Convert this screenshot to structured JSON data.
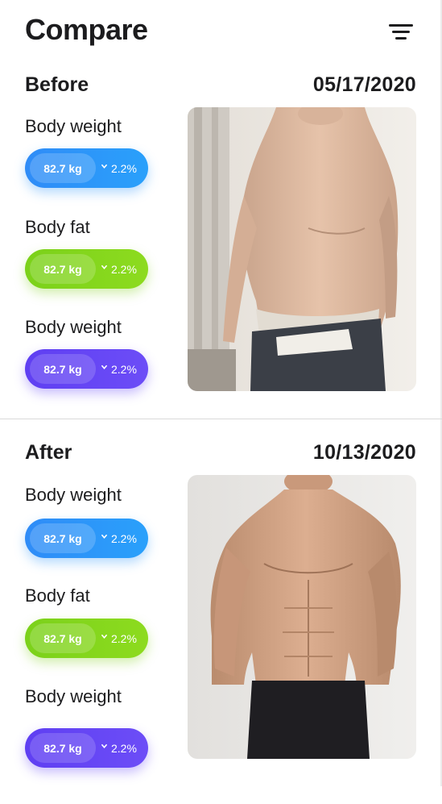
{
  "header": {
    "title": "Compare",
    "filter_icon": "filter-icon"
  },
  "before": {
    "title": "Before",
    "date": "05/17/2020",
    "photo": "body-photo-before",
    "metrics": [
      {
        "label": "Body weight",
        "value": "82.7 kg",
        "delta": "2.2%",
        "color": "#2f8cf7",
        "trend": "down"
      },
      {
        "label": "Body fat",
        "value": "82.7 kg",
        "delta": "2.2%",
        "color": "#7bd11a",
        "trend": "down"
      },
      {
        "label": "Body weight",
        "value": "82.7 kg",
        "delta": "2.2%",
        "color": "#5f3ff2",
        "trend": "down"
      }
    ]
  },
  "after": {
    "title": "After",
    "date": "10/13/2020",
    "photo": "body-photo-after",
    "metrics": [
      {
        "label": "Body weight",
        "value": "82.7 kg",
        "delta": "2.2%",
        "color": "#2f8cf7",
        "trend": "down"
      },
      {
        "label": "Body fat",
        "value": "82.7 kg",
        "delta": "2.2%",
        "color": "#7bd11a",
        "trend": "down"
      },
      {
        "label": "Body weight",
        "value": "82.7 kg",
        "delta": "2.2%",
        "color": "#5f3ff2",
        "trend": "down"
      }
    ]
  }
}
